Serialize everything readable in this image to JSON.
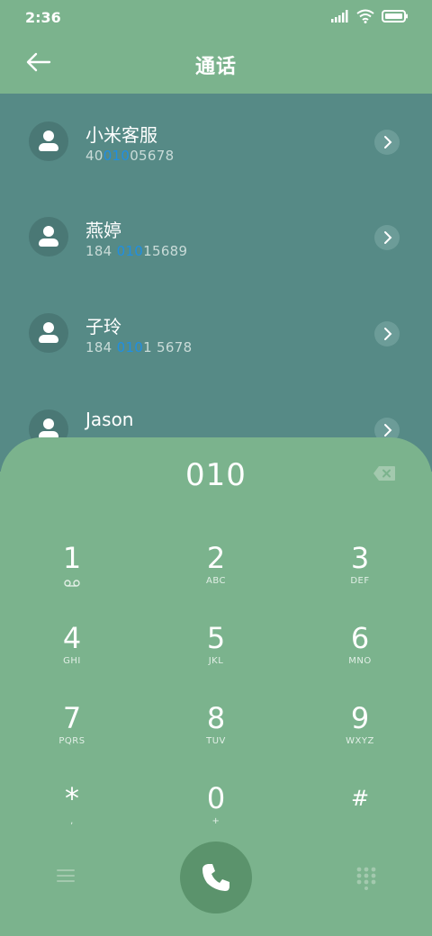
{
  "status_bar": {
    "time": "2:36"
  },
  "header": {
    "title": "通话"
  },
  "contacts": [
    {
      "name": "小米客服",
      "number_pre": "40",
      "number_match": "010",
      "number_post": "05678"
    },
    {
      "name": "燕婷",
      "number_pre": "184 ",
      "number_match": "010",
      "number_post": "15689"
    },
    {
      "name": "子玲",
      "number_pre": "184 ",
      "number_match": "010",
      "number_post": "1 5678"
    },
    {
      "name": "Jason",
      "number_pre": "",
      "number_match": "",
      "number_post": ""
    }
  ],
  "dialpad": {
    "input": "010",
    "keys": [
      {
        "digit": "1",
        "letters": ""
      },
      {
        "digit": "2",
        "letters": "ABC"
      },
      {
        "digit": "3",
        "letters": "DEF"
      },
      {
        "digit": "4",
        "letters": "GHI"
      },
      {
        "digit": "5",
        "letters": "JKL"
      },
      {
        "digit": "6",
        "letters": "MNO"
      },
      {
        "digit": "7",
        "letters": "PQRS"
      },
      {
        "digit": "8",
        "letters": "TUV"
      },
      {
        "digit": "9",
        "letters": "WXYZ"
      },
      {
        "digit": "*",
        "letters": ","
      },
      {
        "digit": "0",
        "letters": "+"
      },
      {
        "digit": "#",
        "letters": ""
      }
    ]
  },
  "icons": {
    "status": [
      "signal-icon",
      "wifi-icon",
      "battery-icon"
    ],
    "header": "back-arrow-icon",
    "key1": "voicemail-icon",
    "bottom": [
      "menu-icon",
      "phone-icon",
      "dialpad-icon"
    ]
  },
  "colors": {
    "background": "#7bb38d",
    "results_background": "#568a86",
    "match_highlight": "#1f8fe3",
    "call_button": "#5b936c"
  }
}
